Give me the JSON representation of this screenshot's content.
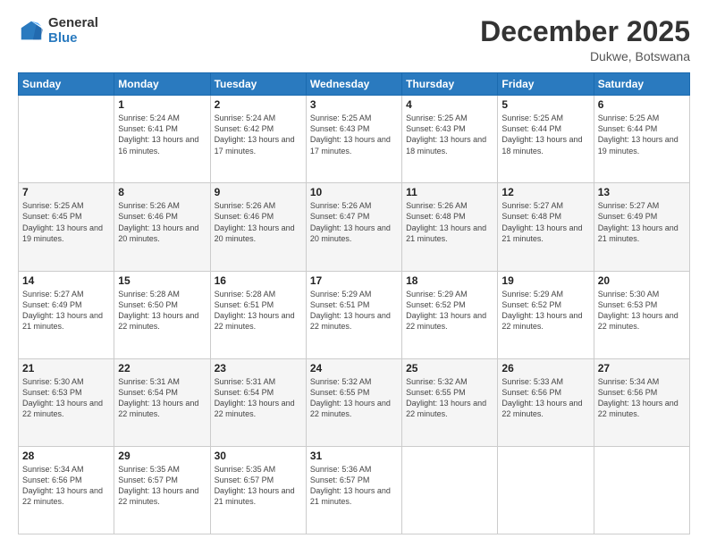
{
  "logo": {
    "general": "General",
    "blue": "Blue"
  },
  "title": "December 2025",
  "subtitle": "Dukwe, Botswana",
  "days": [
    "Sunday",
    "Monday",
    "Tuesday",
    "Wednesday",
    "Thursday",
    "Friday",
    "Saturday"
  ],
  "weeks": [
    [
      {
        "date": "",
        "sunrise": "",
        "sunset": "",
        "daylight": ""
      },
      {
        "date": "1",
        "sunrise": "Sunrise: 5:24 AM",
        "sunset": "Sunset: 6:41 PM",
        "daylight": "Daylight: 13 hours and 16 minutes."
      },
      {
        "date": "2",
        "sunrise": "Sunrise: 5:24 AM",
        "sunset": "Sunset: 6:42 PM",
        "daylight": "Daylight: 13 hours and 17 minutes."
      },
      {
        "date": "3",
        "sunrise": "Sunrise: 5:25 AM",
        "sunset": "Sunset: 6:43 PM",
        "daylight": "Daylight: 13 hours and 17 minutes."
      },
      {
        "date": "4",
        "sunrise": "Sunrise: 5:25 AM",
        "sunset": "Sunset: 6:43 PM",
        "daylight": "Daylight: 13 hours and 18 minutes."
      },
      {
        "date": "5",
        "sunrise": "Sunrise: 5:25 AM",
        "sunset": "Sunset: 6:44 PM",
        "daylight": "Daylight: 13 hours and 18 minutes."
      },
      {
        "date": "6",
        "sunrise": "Sunrise: 5:25 AM",
        "sunset": "Sunset: 6:44 PM",
        "daylight": "Daylight: 13 hours and 19 minutes."
      }
    ],
    [
      {
        "date": "7",
        "sunrise": "Sunrise: 5:25 AM",
        "sunset": "Sunset: 6:45 PM",
        "daylight": "Daylight: 13 hours and 19 minutes."
      },
      {
        "date": "8",
        "sunrise": "Sunrise: 5:26 AM",
        "sunset": "Sunset: 6:46 PM",
        "daylight": "Daylight: 13 hours and 20 minutes."
      },
      {
        "date": "9",
        "sunrise": "Sunrise: 5:26 AM",
        "sunset": "Sunset: 6:46 PM",
        "daylight": "Daylight: 13 hours and 20 minutes."
      },
      {
        "date": "10",
        "sunrise": "Sunrise: 5:26 AM",
        "sunset": "Sunset: 6:47 PM",
        "daylight": "Daylight: 13 hours and 20 minutes."
      },
      {
        "date": "11",
        "sunrise": "Sunrise: 5:26 AM",
        "sunset": "Sunset: 6:48 PM",
        "daylight": "Daylight: 13 hours and 21 minutes."
      },
      {
        "date": "12",
        "sunrise": "Sunrise: 5:27 AM",
        "sunset": "Sunset: 6:48 PM",
        "daylight": "Daylight: 13 hours and 21 minutes."
      },
      {
        "date": "13",
        "sunrise": "Sunrise: 5:27 AM",
        "sunset": "Sunset: 6:49 PM",
        "daylight": "Daylight: 13 hours and 21 minutes."
      }
    ],
    [
      {
        "date": "14",
        "sunrise": "Sunrise: 5:27 AM",
        "sunset": "Sunset: 6:49 PM",
        "daylight": "Daylight: 13 hours and 21 minutes."
      },
      {
        "date": "15",
        "sunrise": "Sunrise: 5:28 AM",
        "sunset": "Sunset: 6:50 PM",
        "daylight": "Daylight: 13 hours and 22 minutes."
      },
      {
        "date": "16",
        "sunrise": "Sunrise: 5:28 AM",
        "sunset": "Sunset: 6:51 PM",
        "daylight": "Daylight: 13 hours and 22 minutes."
      },
      {
        "date": "17",
        "sunrise": "Sunrise: 5:29 AM",
        "sunset": "Sunset: 6:51 PM",
        "daylight": "Daylight: 13 hours and 22 minutes."
      },
      {
        "date": "18",
        "sunrise": "Sunrise: 5:29 AM",
        "sunset": "Sunset: 6:52 PM",
        "daylight": "Daylight: 13 hours and 22 minutes."
      },
      {
        "date": "19",
        "sunrise": "Sunrise: 5:29 AM",
        "sunset": "Sunset: 6:52 PM",
        "daylight": "Daylight: 13 hours and 22 minutes."
      },
      {
        "date": "20",
        "sunrise": "Sunrise: 5:30 AM",
        "sunset": "Sunset: 6:53 PM",
        "daylight": "Daylight: 13 hours and 22 minutes."
      }
    ],
    [
      {
        "date": "21",
        "sunrise": "Sunrise: 5:30 AM",
        "sunset": "Sunset: 6:53 PM",
        "daylight": "Daylight: 13 hours and 22 minutes."
      },
      {
        "date": "22",
        "sunrise": "Sunrise: 5:31 AM",
        "sunset": "Sunset: 6:54 PM",
        "daylight": "Daylight: 13 hours and 22 minutes."
      },
      {
        "date": "23",
        "sunrise": "Sunrise: 5:31 AM",
        "sunset": "Sunset: 6:54 PM",
        "daylight": "Daylight: 13 hours and 22 minutes."
      },
      {
        "date": "24",
        "sunrise": "Sunrise: 5:32 AM",
        "sunset": "Sunset: 6:55 PM",
        "daylight": "Daylight: 13 hours and 22 minutes."
      },
      {
        "date": "25",
        "sunrise": "Sunrise: 5:32 AM",
        "sunset": "Sunset: 6:55 PM",
        "daylight": "Daylight: 13 hours and 22 minutes."
      },
      {
        "date": "26",
        "sunrise": "Sunrise: 5:33 AM",
        "sunset": "Sunset: 6:56 PM",
        "daylight": "Daylight: 13 hours and 22 minutes."
      },
      {
        "date": "27",
        "sunrise": "Sunrise: 5:34 AM",
        "sunset": "Sunset: 6:56 PM",
        "daylight": "Daylight: 13 hours and 22 minutes."
      }
    ],
    [
      {
        "date": "28",
        "sunrise": "Sunrise: 5:34 AM",
        "sunset": "Sunset: 6:56 PM",
        "daylight": "Daylight: 13 hours and 22 minutes."
      },
      {
        "date": "29",
        "sunrise": "Sunrise: 5:35 AM",
        "sunset": "Sunset: 6:57 PM",
        "daylight": "Daylight: 13 hours and 22 minutes."
      },
      {
        "date": "30",
        "sunrise": "Sunrise: 5:35 AM",
        "sunset": "Sunset: 6:57 PM",
        "daylight": "Daylight: 13 hours and 21 minutes."
      },
      {
        "date": "31",
        "sunrise": "Sunrise: 5:36 AM",
        "sunset": "Sunset: 6:57 PM",
        "daylight": "Daylight: 13 hours and 21 minutes."
      },
      {
        "date": "",
        "sunrise": "",
        "sunset": "",
        "daylight": ""
      },
      {
        "date": "",
        "sunrise": "",
        "sunset": "",
        "daylight": ""
      },
      {
        "date": "",
        "sunrise": "",
        "sunset": "",
        "daylight": ""
      }
    ]
  ]
}
